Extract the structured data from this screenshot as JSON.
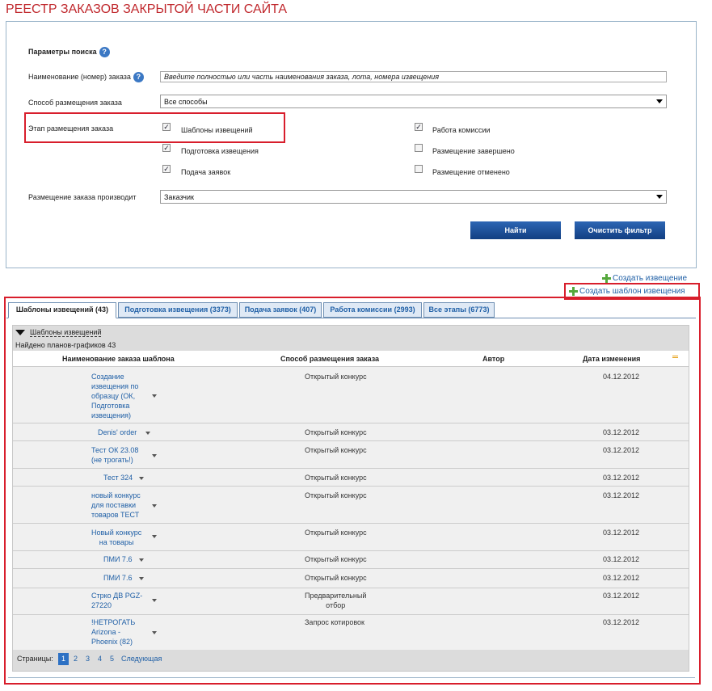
{
  "page_title": "РЕЕСТР ЗАКАЗОВ ЗАКРЫТОЙ ЧАСТИ САЙТА",
  "search": {
    "section_title": "Параметры поиска",
    "name_label": "Наименование (номер) заказа",
    "name_value": "Введите полностью или часть наименования заказа, лота, номера извещения",
    "method_label": "Способ размещения заказа",
    "method_value": "Все способы",
    "stage_label": "Этап размещения заказа",
    "stages": [
      {
        "label": "Шаблоны извещений",
        "checked": true
      },
      {
        "label": "Подготовка извещения",
        "checked": true
      },
      {
        "label": "Подача заявок",
        "checked": true
      },
      {
        "label": "Работа комиссии",
        "checked": true
      },
      {
        "label": "Размещение завершено",
        "checked": false
      },
      {
        "label": "Размещение отменено",
        "checked": false
      }
    ],
    "producer_label": "Размещение заказа производит",
    "producer_value": "Заказчик",
    "find_button": "Найти",
    "clear_button": "Очистить фильтр"
  },
  "actions": {
    "create_notice": "Создать извещение",
    "create_template": "Создать шаблон извещения"
  },
  "tabs": [
    {
      "label": "Шаблоны извещений (43)",
      "active": true
    },
    {
      "label": "Подготовка извещения (3373)",
      "active": false
    },
    {
      "label": "Подача заявок (407)",
      "active": false
    },
    {
      "label": "Работа комиссии (2993)",
      "active": false
    },
    {
      "label": "Все этапы (6773)",
      "active": false
    }
  ],
  "group": {
    "title": "Шаблоны извещений",
    "found": "Найдено планов-графиков 43"
  },
  "table": {
    "headers": [
      "Наименование заказа шаблона",
      "Способ размещения заказа",
      "Автор",
      "Дата изменения"
    ],
    "rows": [
      {
        "name": "Создание\nизвещения по\nобразцу (ОК,\nПодготовка\nизвещения)",
        "method": "Открытый конкурс",
        "author": "",
        "date": "04.12.2012"
      },
      {
        "name": "Denis' order",
        "method": "Открытый конкурс",
        "author": "",
        "date": "03.12.2012"
      },
      {
        "name": "Тест ОК 23.08\n(не трогать!)",
        "method": "Открытый конкурс",
        "author": "",
        "date": "03.12.2012"
      },
      {
        "name": "Тест 324",
        "method": "Открытый конкурс",
        "author": "",
        "date": "03.12.2012"
      },
      {
        "name": "новый конкурс\nдля поставки\nтоваров ТЕСТ",
        "method": "Открытый конкурс",
        "author": "",
        "date": "03.12.2012"
      },
      {
        "name": "Новый конкурс\nна товары",
        "method": "Открытый конкурс",
        "author": "",
        "date": "03.12.2012"
      },
      {
        "name": "ПМИ 7.6",
        "method": "Открытый конкурс",
        "author": "",
        "date": "03.12.2012"
      },
      {
        "name": "ПМИ 7.6",
        "method": "Открытый конкурс",
        "author": "",
        "date": "03.12.2012"
      },
      {
        "name": "Стрко ДВ PGZ-\n27220",
        "method": "Предварительный\nотбор",
        "author": "",
        "date": "03.12.2012"
      },
      {
        "name": "!НЕТРОГАТЬ\nArizona -\nPhoenix (82)",
        "method": "Запрос котировок",
        "author": "",
        "date": "03.12.2012"
      }
    ]
  },
  "pagination": {
    "label": "Страницы:",
    "pages": [
      "1",
      "2",
      "3",
      "4",
      "5"
    ],
    "next": "Следующая"
  },
  "colors": {
    "title_red": "#c0282d",
    "link_blue": "#1f5fa6",
    "highlight_red": "#d81e2c"
  }
}
